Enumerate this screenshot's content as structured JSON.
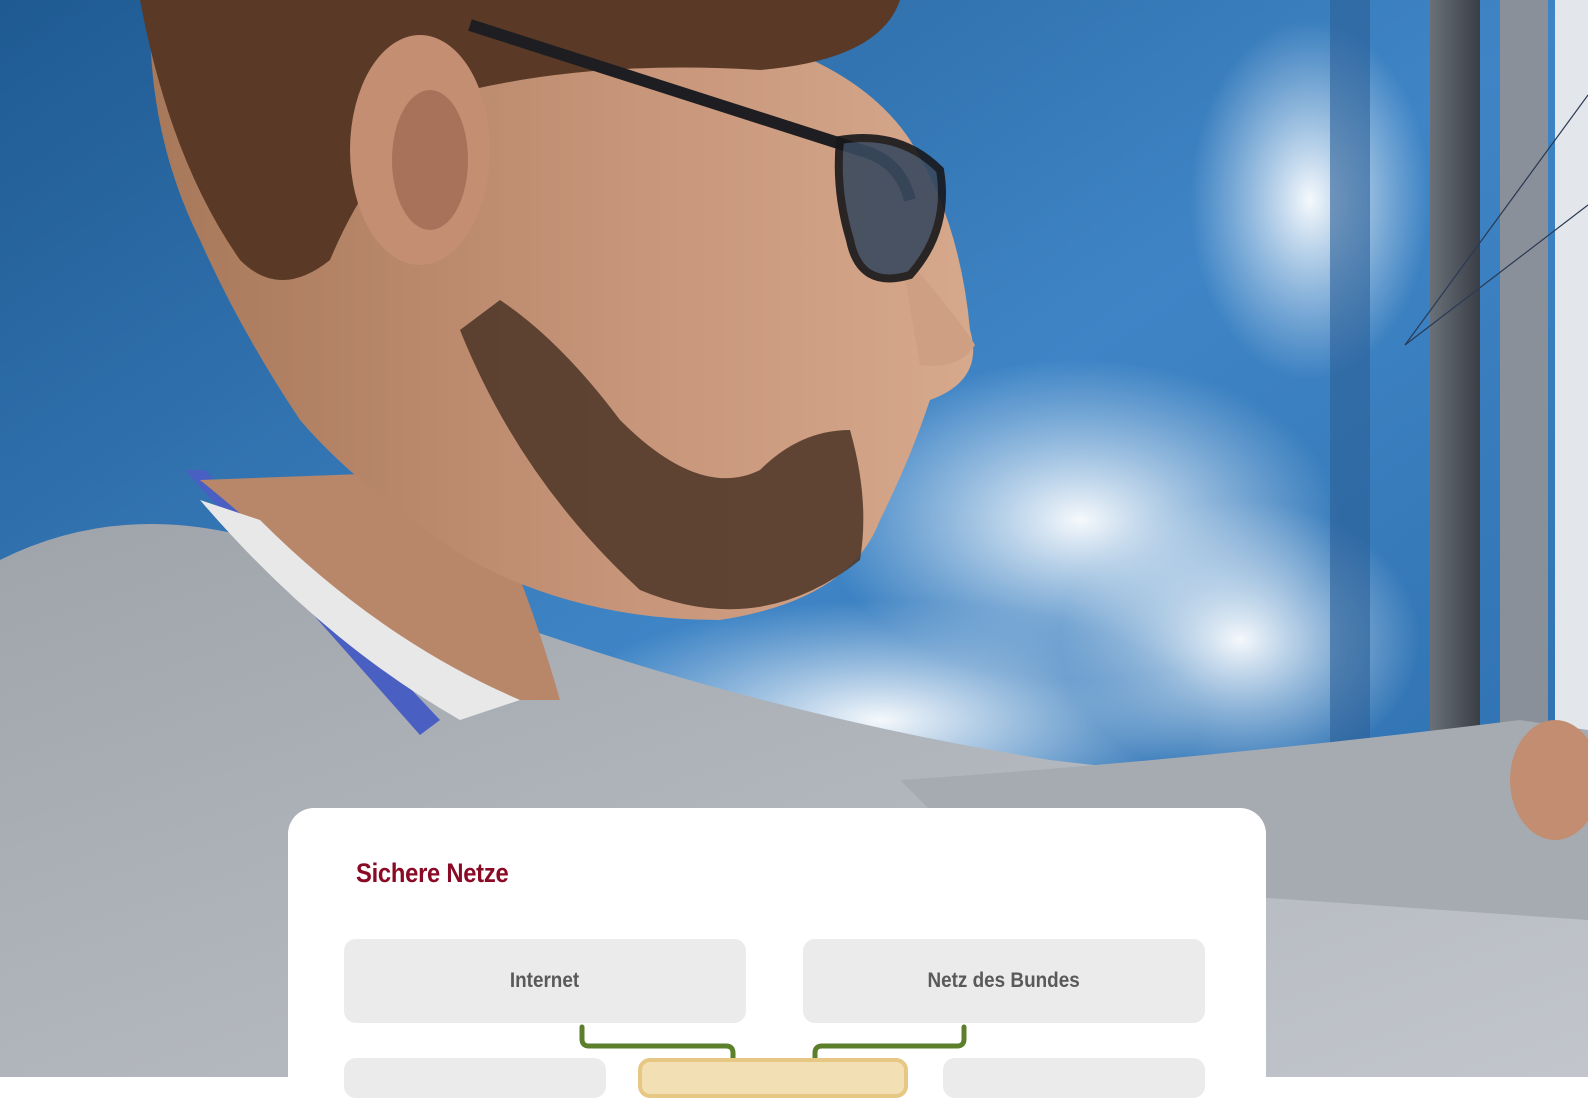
{
  "diagram": {
    "title": "Sichere Netze",
    "nodes": [
      {
        "id": "internet",
        "label": "Internet"
      },
      {
        "id": "netz-des-bundes",
        "label": "Netz des Bundes"
      }
    ],
    "connector_color": "#5b7f2b",
    "title_color": "#8a0a26",
    "box_color": "#ebebeb",
    "highlight_box_color": "#f3dfb4"
  }
}
